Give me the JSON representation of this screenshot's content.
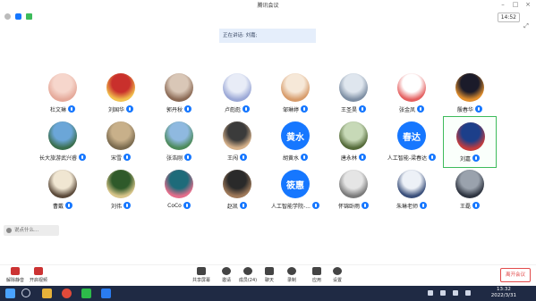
{
  "window": {
    "title": "腾讯会议"
  },
  "status": {
    "time": "14:52"
  },
  "speaking": {
    "text": "正在讲话: 刘嘉;"
  },
  "participants": [
    {
      "name": "杜文琳",
      "avatar": "photo",
      "colors": [
        "#f6d6cc",
        "#e5a99a"
      ]
    },
    {
      "name": "刘国华",
      "avatar": "photo",
      "colors": [
        "#c9302c",
        "#f2c14e"
      ]
    },
    {
      "name": "郭丹秋",
      "avatar": "photo",
      "colors": [
        "#d9c7b7",
        "#8b6a55"
      ]
    },
    {
      "name": "卢彪彪",
      "avatar": "photo",
      "colors": [
        "#e8ecf7",
        "#9aa7d6"
      ]
    },
    {
      "name": "邹琳婷",
      "avatar": "photo",
      "colors": [
        "#f6e8d8",
        "#d79b6a"
      ]
    },
    {
      "name": "王圣昊",
      "avatar": "photo",
      "colors": [
        "#dfe6ee",
        "#7d8ea3"
      ]
    },
    {
      "name": "张金凤",
      "avatar": "photo",
      "colors": [
        "#ffffff",
        "#e46060"
      ]
    },
    {
      "name": "殷春华",
      "avatar": "photo",
      "colors": [
        "#1b1b2a",
        "#e28f2d"
      ]
    },
    {
      "name": "长大旅游武兴睿",
      "avatar": "photo",
      "colors": [
        "#6ba6d8",
        "#3a6e4d"
      ]
    },
    {
      "name": "宋雪",
      "avatar": "photo",
      "colors": [
        "#c8b08a",
        "#7a6a4e"
      ]
    },
    {
      "name": "张浩刚",
      "avatar": "photo",
      "colors": [
        "#8fb9e0",
        "#4c8a5a"
      ]
    },
    {
      "name": "王闯",
      "avatar": "photo",
      "colors": [
        "#3b3b3b",
        "#d6b18a"
      ]
    },
    {
      "name": "胡黄水",
      "avatar": "text",
      "text": "黄水"
    },
    {
      "name": "唐永林",
      "avatar": "photo",
      "colors": [
        "#c7d9b7",
        "#556b3a"
      ]
    },
    {
      "name": "人工智能-梁春达",
      "avatar": "text",
      "text": "春达"
    },
    {
      "name": "刘嘉",
      "avatar": "photo",
      "colors": [
        "#1c3f8a",
        "#c63c3c"
      ],
      "selected": true
    },
    {
      "name": "曹戴",
      "avatar": "photo",
      "colors": [
        "#f0e6d2",
        "#5b4a3a"
      ]
    },
    {
      "name": "刘伟",
      "avatar": "photo",
      "colors": [
        "#2f5a2a",
        "#d8c58a"
      ]
    },
    {
      "name": "CoCo",
      "avatar": "photo",
      "colors": [
        "#1e6b7a",
        "#e46e8b"
      ]
    },
    {
      "name": "赵凯",
      "avatar": "photo",
      "colors": [
        "#2a2a2a",
        "#a07a5a"
      ]
    },
    {
      "name": "人工智能学院-...",
      "avatar": "text",
      "text": "筱惠"
    },
    {
      "name": "怀锦卧雨",
      "avatar": "photo",
      "colors": [
        "#e5e5e5",
        "#7a7a7a"
      ]
    },
    {
      "name": "朱琳老师",
      "avatar": "photo",
      "colors": [
        "#edf1f7",
        "#3a4f7a"
      ]
    },
    {
      "name": "王磊",
      "avatar": "photo",
      "colors": [
        "#9aa2ad",
        "#2e3440"
      ]
    }
  ],
  "chat": {
    "placeholder": "说点什么..."
  },
  "toolbar": {
    "mute": "解除静音",
    "video": "开启视频",
    "share": "共享屏幕",
    "invite": "邀请",
    "members": "成员(24)",
    "chat": "聊天",
    "record": "录制",
    "apps": "应用",
    "settings": "设置",
    "leave": "离开会议"
  },
  "taskbar": {
    "time": "13:32",
    "date": "2022/3/31"
  },
  "colors": {
    "accent": "#1677ff",
    "leave": "#e24a4a",
    "selected": "#3dbb5b",
    "taskbar": "#1f2a44"
  }
}
